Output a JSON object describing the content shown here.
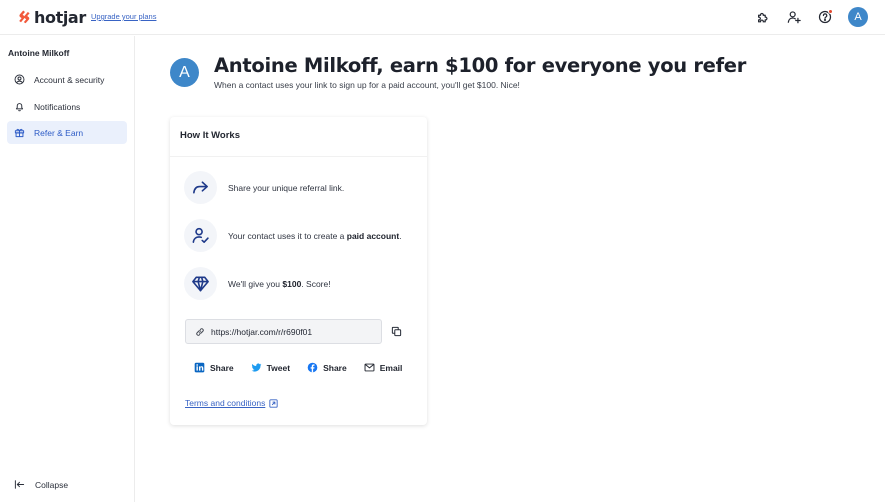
{
  "brand": {
    "name": "hotjar",
    "accent": "#f25a3c"
  },
  "topbar": {
    "upgrade_link": "Upgrade your plans",
    "icons": [
      "puzzle-icon",
      "invite-user-icon",
      "help-icon"
    ],
    "avatar_initial": "A",
    "avatar_color": "#3e87c9"
  },
  "sidebar": {
    "user_name": "Antoine Milkoff",
    "items": [
      {
        "label": "Account & security",
        "icon": "user-circle-icon",
        "active": false
      },
      {
        "label": "Notifications",
        "icon": "bell-icon",
        "active": false
      },
      {
        "label": "Refer & Earn",
        "icon": "gift-icon",
        "active": true
      }
    ],
    "collapse_label": "Collapse"
  },
  "header": {
    "avatar_initial": "A",
    "title": "Antoine Milkoff, earn $100 for everyone you refer",
    "subtitle": "When a contact uses your link to sign up for a paid account, you'll get $100. Nice!"
  },
  "card": {
    "title": "How It Works",
    "steps": [
      {
        "icon": "share-arrow-icon",
        "text_before": "Share your unique referral link.",
        "bold": "",
        "text_after": ""
      },
      {
        "icon": "user-check-icon",
        "text_before": "Your contact uses it to create a ",
        "bold": "paid account",
        "text_after": "."
      },
      {
        "icon": "diamond-icon",
        "text_before": "We'll give you ",
        "bold": "$100",
        "text_after": ". Score!"
      }
    ],
    "referral_link": "https://hotjar.com/r/r690f01",
    "share_buttons": [
      {
        "label": "Share",
        "icon": "linkedin-icon"
      },
      {
        "label": "Tweet",
        "icon": "twitter-icon"
      },
      {
        "label": "Share",
        "icon": "facebook-icon"
      },
      {
        "label": "Email",
        "icon": "email-icon"
      }
    ],
    "terms_label": "Terms and conditions"
  }
}
